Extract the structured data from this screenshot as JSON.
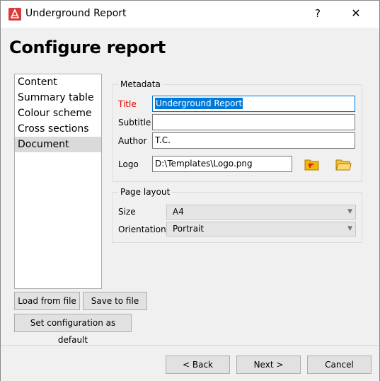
{
  "window": {
    "title": "Underground Report",
    "help": "?",
    "close": "✕"
  },
  "heading": "Configure report",
  "nav": {
    "items": [
      "Content",
      "Summary table",
      "Colour scheme",
      "Cross sections",
      "Document"
    ],
    "selected": 4
  },
  "metadata": {
    "group_title": "Metadata",
    "title_label": "Title",
    "title_value": "Underground Report",
    "subtitle_label": "Subtitle",
    "subtitle_value": "",
    "author_label": "Author",
    "author_value": "T.C.",
    "logo_label": "Logo",
    "logo_value": "D:\\Templates\\Logo.png"
  },
  "page_layout": {
    "group_title": "Page layout",
    "size_label": "Size",
    "size_value": "A4",
    "orientation_label": "Orientation",
    "orientation_value": "Portrait"
  },
  "buttons": {
    "load": "Load from file",
    "save": "Save to file",
    "set_default": "Set configuration as default",
    "back": "< Back",
    "next": "Next >",
    "cancel": "Cancel"
  },
  "colors": {
    "accent": "#0078d7",
    "required_label": "#e00000",
    "app_icon": "#d93a3a"
  }
}
